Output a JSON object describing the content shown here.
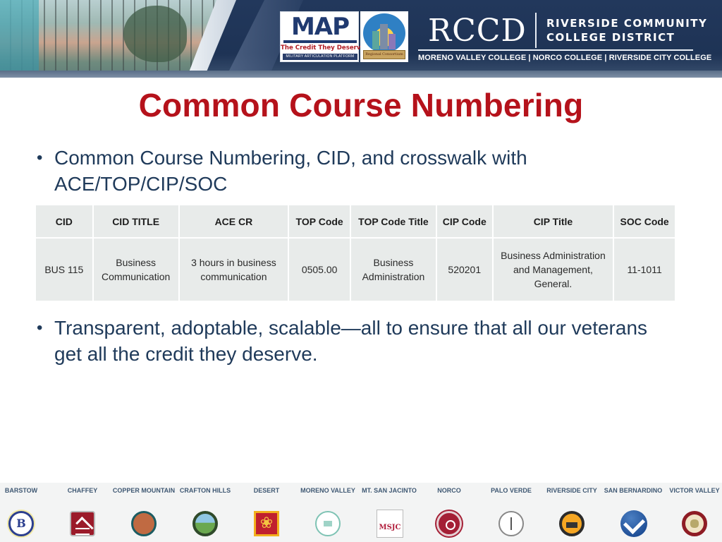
{
  "header": {
    "map_logo": {
      "word": "MAP",
      "tagline": "The Credit They Deserve",
      "subtitle": "MILITARY ARTICULATION PLATFORM"
    },
    "consortium_logo": {
      "text": "Regional Consortium"
    },
    "rccd_logo": {
      "abbreviation": "RCCD",
      "name_line1": "RIVERSIDE COMMUNITY",
      "name_line2": "COLLEGE DISTRICT",
      "colleges": "MORENO VALLEY COLLEGE | NORCO COLLEGE | RIVERSIDE CITY COLLEGE"
    }
  },
  "slide": {
    "title": "Common Course Numbering",
    "bullets": [
      "Common Course Numbering, CID, and crosswalk with ACE/TOP/CIP/SOC",
      "Transparent, adoptable, scalable—all to ensure that all our veterans get all the credit they deserve."
    ],
    "bullet_glyph": "•"
  },
  "table": {
    "headers": [
      "CID",
      "CID TITLE",
      "ACE CR",
      "TOP Code",
      "TOP Code Title",
      "CIP Code",
      "CIP Title",
      "SOC Code"
    ],
    "rows": [
      [
        "BUS 115",
        "Business Communication",
        "3 hours in business communication",
        "0505.00",
        "Business Administration",
        "520201",
        "Business Administration and Management, General.",
        "11-1011"
      ]
    ]
  },
  "footer": {
    "colleges": [
      {
        "name": "BARSTOW",
        "seal_text": "B"
      },
      {
        "name": "CHAFFEY",
        "seal_text": ""
      },
      {
        "name": "COPPER MOUNTAIN",
        "seal_text": ""
      },
      {
        "name": "CRAFTON HILLS",
        "seal_text": ""
      },
      {
        "name": "DESERT",
        "seal_text": "❀"
      },
      {
        "name": "MORENO VALLEY",
        "seal_text": ""
      },
      {
        "name": "MT. SAN JACINTO",
        "seal_text": "MSJC"
      },
      {
        "name": "NORCO",
        "seal_text": ""
      },
      {
        "name": "PALO VERDE",
        "seal_text": ""
      },
      {
        "name": "RIVERSIDE CITY",
        "seal_text": ""
      },
      {
        "name": "SAN BERNARDINO",
        "seal_text": ""
      },
      {
        "name": "VICTOR VALLEY",
        "seal_text": ""
      }
    ]
  },
  "colors": {
    "title_red": "#b5121b",
    "body_navy": "#1f3a5a",
    "banner_navy": "#1e3355",
    "table_cell": "#e8ebea"
  }
}
